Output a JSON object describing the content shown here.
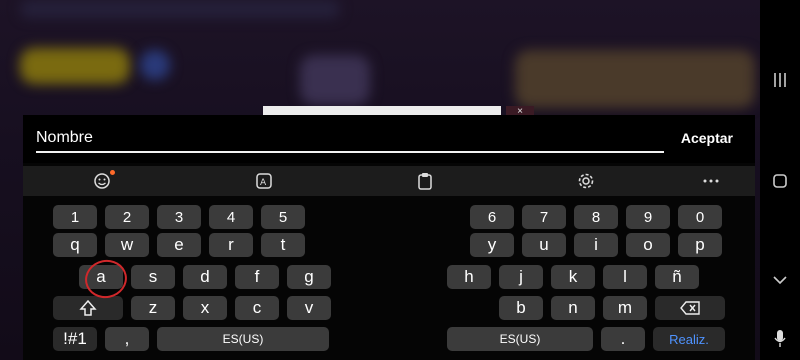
{
  "input": {
    "value": "Nombre"
  },
  "accept_label": "Aceptar",
  "popup": {
    "close_label": "×"
  },
  "toolbar": {
    "icons": [
      "emoji-icon",
      "translate-icon",
      "clipboard-icon",
      "settings-icon",
      "more-icon"
    ]
  },
  "keyboard": {
    "left": {
      "numbers": [
        "1",
        "2",
        "3",
        "4",
        "5"
      ],
      "row1": [
        "q",
        "w",
        "e",
        "r",
        "t"
      ],
      "row2": [
        "a",
        "s",
        "d",
        "f",
        "g"
      ],
      "row3": [
        "z",
        "x",
        "c",
        "v"
      ],
      "symbols_label": "!#1",
      "comma_label": ",",
      "space_label": "ES(US)"
    },
    "right": {
      "numbers": [
        "6",
        "7",
        "8",
        "9",
        "0"
      ],
      "row1": [
        "y",
        "u",
        "i",
        "o",
        "p"
      ],
      "row2": [
        "h",
        "j",
        "k",
        "l",
        "ñ"
      ],
      "row3": [
        "b",
        "n",
        "m"
      ],
      "space_label": "ES(US)",
      "period_label": ".",
      "done_label": "Realiz."
    }
  },
  "colors": {
    "accent": "#4f93ff",
    "badge": "#ff6a2a",
    "highlight_circle": "#d0282b"
  }
}
